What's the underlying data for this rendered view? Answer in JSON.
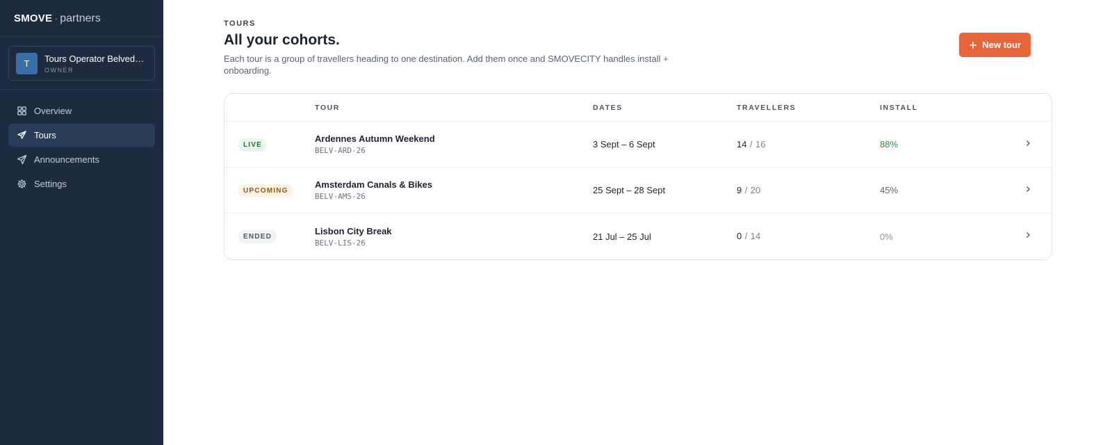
{
  "brand": {
    "strong": "SMOVE",
    "dot": "·",
    "light": "partners"
  },
  "account": {
    "initial": "T",
    "name": "Tours Operator Belvedere",
    "role": "OWNER"
  },
  "nav": [
    {
      "label": "Overview",
      "icon": "grid-icon"
    },
    {
      "label": "Tours",
      "icon": "plane-icon",
      "active": true
    },
    {
      "label": "Announcements",
      "icon": "send-icon"
    },
    {
      "label": "Settings",
      "icon": "gear-icon"
    }
  ],
  "header": {
    "eyebrow": "TOURS",
    "title": "All your cohorts.",
    "description": "Each tour is a group of travellers heading to one destination. Add them once and SMOVECITY handles install + onboarding."
  },
  "new_tour_button": {
    "label": "New tour"
  },
  "table": {
    "headers": {
      "tour": "TOUR",
      "dates": "DATES",
      "travellers": "TRAVELLERS",
      "install": "INSTALL"
    },
    "rows": [
      {
        "status": "LIVE",
        "name": "Ardennes Autumn Weekend",
        "code": "BELV-ARD-26",
        "dates": "3 Sept – 6 Sept",
        "travellers": "14",
        "sep": "/",
        "capacity": "16",
        "install": "88%"
      },
      {
        "status": "UPCOMING",
        "name": "Amsterdam Canals & Bikes",
        "code": "BELV-AMS-26",
        "dates": "25 Sept – 28 Sept",
        "travellers": "9",
        "sep": "/",
        "capacity": "20",
        "install": "45%"
      },
      {
        "status": "ENDED",
        "name": "Lisbon City Break",
        "code": "BELV-LIS-26",
        "dates": "21 Jul – 25 Jul",
        "travellers": "0",
        "sep": "/",
        "capacity": "14",
        "install": "0%"
      }
    ]
  },
  "colors": {
    "sidebar": "#1c2b40",
    "accent": "#e8643a",
    "install_high": "#2f8a4a",
    "install_mid": "#5a6272",
    "install_zero": "#8a909c"
  }
}
